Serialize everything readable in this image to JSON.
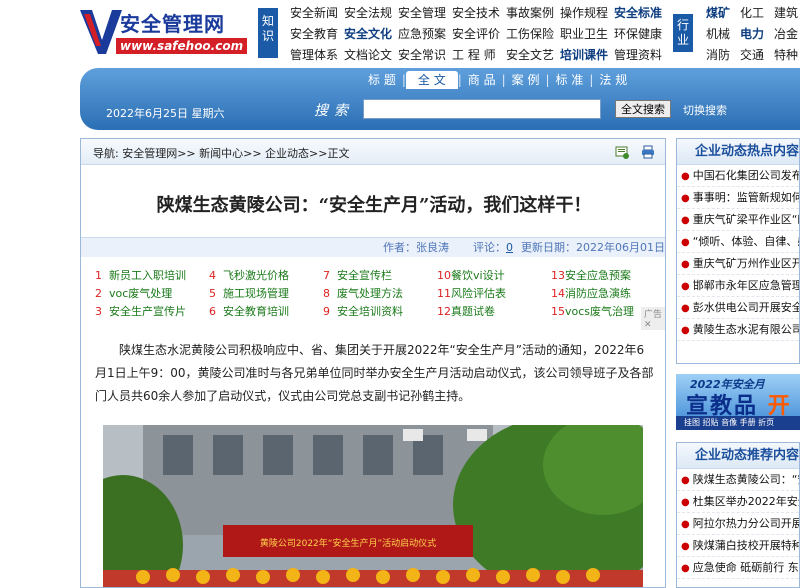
{
  "logo": {
    "cn": "安全管理网",
    "en": "www.safehoo.com"
  },
  "knowledge_label": "知识",
  "industry_label": "行业",
  "nav_knowledge": [
    [
      {
        "t": "安全新闻"
      },
      {
        "t": "安全法规"
      },
      {
        "t": "安全管理"
      },
      {
        "t": "安全技术"
      },
      {
        "t": "事故案例"
      },
      {
        "t": "操作规程"
      },
      {
        "t": "安全标准",
        "b": true
      }
    ],
    [
      {
        "t": "安全教育"
      },
      {
        "t": "安全文化",
        "b": true
      },
      {
        "t": "应急预案"
      },
      {
        "t": "安全评价"
      },
      {
        "t": "工伤保险"
      },
      {
        "t": "职业卫生"
      },
      {
        "t": "环保健康"
      }
    ],
    [
      {
        "t": "管理体系"
      },
      {
        "t": "文档论文"
      },
      {
        "t": "安全常识"
      },
      {
        "t": "工 程 师"
      },
      {
        "t": "安全文艺"
      },
      {
        "t": "培训课件",
        "b": true
      },
      {
        "t": "管理资料"
      }
    ]
  ],
  "nav_industry": [
    [
      {
        "t": "煤矿",
        "b": true
      },
      {
        "t": "化工"
      },
      {
        "t": "建筑"
      }
    ],
    [
      {
        "t": "机械"
      },
      {
        "t": "电力",
        "b": true
      },
      {
        "t": "冶金"
      }
    ],
    [
      {
        "t": "消防"
      },
      {
        "t": "交通"
      },
      {
        "t": "特种"
      }
    ]
  ],
  "search": {
    "tabs": [
      "标 题",
      "全 文",
      "商 品",
      "案 例",
      "标 准",
      "法 规"
    ],
    "active_tab": 1,
    "date": "2022年6月25日 星期六",
    "label": "搜索",
    "input_value": "",
    "button": "全文搜索",
    "switch": "切换搜索"
  },
  "breadcrumb": "导航: 安全管理网>> 新闻中心>> 企业动态>>正文",
  "article": {
    "title": "陕煤生态黄陵公司：“安全生产月”活动，我们这样干！",
    "author": "作者：张良涛",
    "comments_label": "评论：",
    "comments_count": "0",
    "updated": "更新日期：2022年06月01日",
    "body": "陕煤生态水泥黄陵公司积极响应中、省、集团关于开展2022年“安全生产月”活动的通知，2022年6月1日上午9：00，黄陵公司准时与各兄弟单位同时举办安全生产月活动启动仪式，该公司领导班子及各部门人员共60余人参加了启动仪式，仪式由公司党总支副书记孙鹤主持。",
    "photo_banner": "黄陵公司2022年“安全生产月”活动启动仪式"
  },
  "related_links": [
    {
      "n": "1",
      "t": "新员工入职培训"
    },
    {
      "n": "4",
      "t": "飞秒激光价格"
    },
    {
      "n": "7",
      "t": "安全宣传栏"
    },
    {
      "n": "10",
      "t": "餐饮vi设计"
    },
    {
      "n": "13",
      "t": "安全应急预案"
    },
    {
      "n": "2",
      "t": "voc废气处理"
    },
    {
      "n": "5",
      "t": "施工现场管理"
    },
    {
      "n": "8",
      "t": "废气处理方法"
    },
    {
      "n": "11",
      "t": "风险评估表"
    },
    {
      "n": "14",
      "t": "消防应急演练"
    },
    {
      "n": "3",
      "t": "安全生产宣传片"
    },
    {
      "n": "6",
      "t": "安全教育培训"
    },
    {
      "n": "9",
      "t": "安全培训资料"
    },
    {
      "n": "12",
      "t": "真题试卷"
    },
    {
      "n": "15",
      "t": "vocs废气治理"
    }
  ],
  "ad_badge": "广告 ✕",
  "sidebar": {
    "hot_title": "企业动态热点内容",
    "hot_items": [
      "中国石化集团公司发布",
      "事事明：监管新规如何",
      "重庆气矿梁平作业区“四",
      "“倾听、体验、自律、感",
      "重庆气矿万州作业区开",
      "邯郸市永年区应急管理",
      "彭水供电公司开展安全",
      "黄陵生态水泥有限公司"
    ],
    "promo_year": "2022年安全月",
    "promo_main": "宣教品",
    "promo_accent": "开",
    "promo_sub": "挂图 招贴 音像 手册 折页",
    "rec_title": "企业动态推荐内容",
    "rec_items": [
      "陕煤生态黄陵公司：“安",
      "杜集区举办2022年安全",
      "阿拉尔热力分公司开展",
      "陕煤蒲白技校开展特种",
      "应急使命 砥砺前行 东"
    ]
  },
  "colors": {
    "brand_blue": "#1b5aa6",
    "brand_red": "#d41f26",
    "link_green": "#1a7a1a"
  }
}
